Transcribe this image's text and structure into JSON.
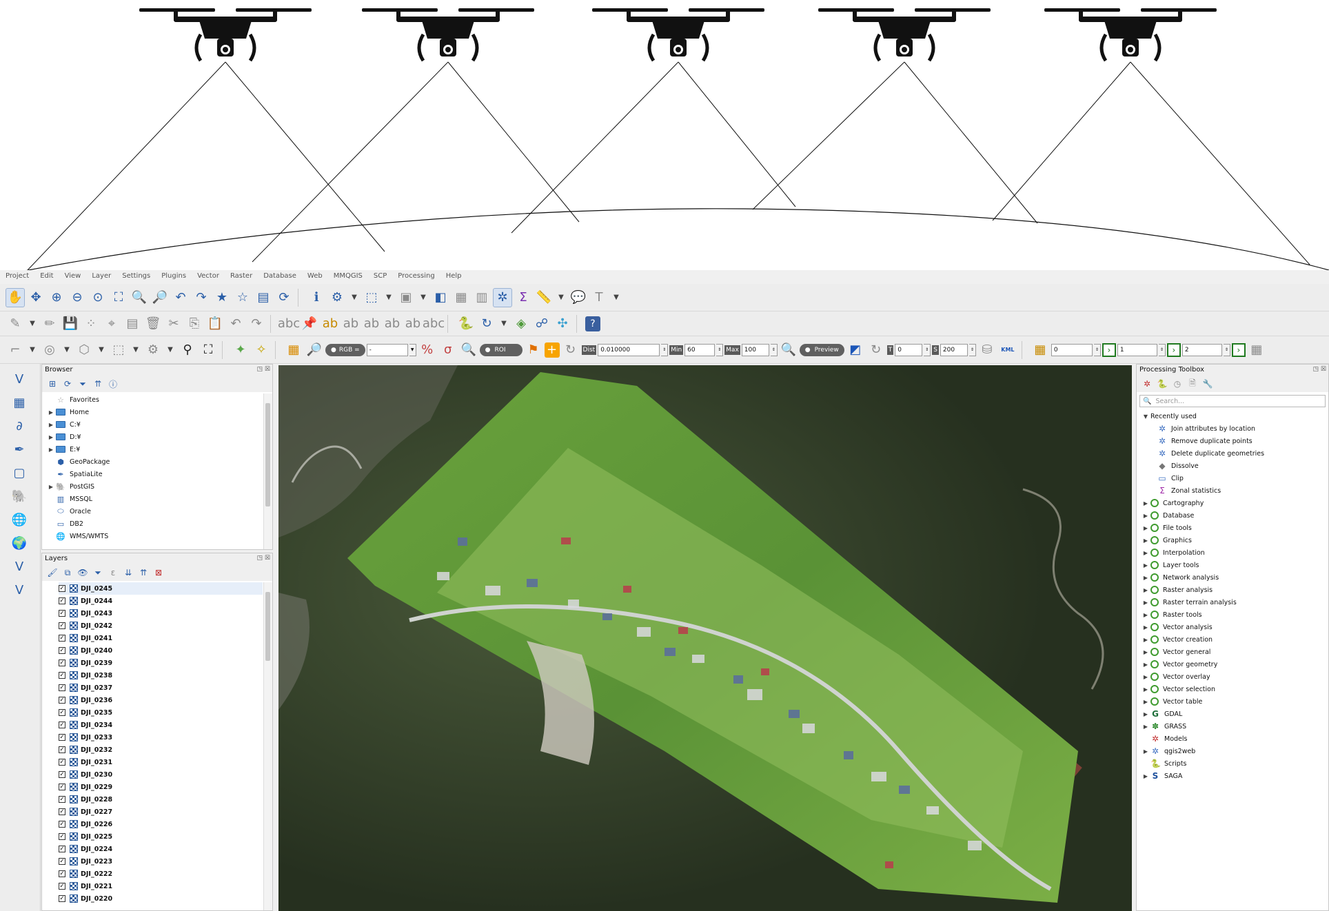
{
  "menu": [
    "Project",
    "Edit",
    "View",
    "Layer",
    "Settings",
    "Plugins",
    "Vector",
    "Raster",
    "Database",
    "Web",
    "MMQGIS",
    "SCP",
    "Processing",
    "Help"
  ],
  "scp": {
    "rgb_label": "RGB =",
    "rgb_value": "-",
    "roi_label": "ROI",
    "dist_label": "Dist",
    "dist_value": "0.010000",
    "min_label": "Min",
    "min_value": "60",
    "max_label": "Max",
    "max_value": "100",
    "preview_label": "Preview",
    "t_label": "T",
    "t_value": "0",
    "s_label": "S",
    "s_value": "200",
    "kml_label": "KML",
    "band1": "0",
    "band2": "1",
    "band3": "2"
  },
  "browser": {
    "title": "Browser",
    "items": [
      {
        "label": "Favorites",
        "icon": "star-icon",
        "expand": false
      },
      {
        "label": "Home",
        "icon": "folder-icon",
        "expand": true
      },
      {
        "label": "C:¥",
        "icon": "folder-icon",
        "expand": true
      },
      {
        "label": "D:¥",
        "icon": "folder-icon",
        "expand": true
      },
      {
        "label": "E:¥",
        "icon": "folder-icon",
        "expand": true
      },
      {
        "label": "GeoPackage",
        "icon": "geopackage-icon",
        "expand": false
      },
      {
        "label": "SpatiaLite",
        "icon": "spatialite-icon",
        "expand": false
      },
      {
        "label": "PostGIS",
        "icon": "postgis-icon",
        "expand": true
      },
      {
        "label": "MSSQL",
        "icon": "mssql-icon",
        "expand": false
      },
      {
        "label": "Oracle",
        "icon": "oracle-icon",
        "expand": false
      },
      {
        "label": "DB2",
        "icon": "db2-icon",
        "expand": false
      },
      {
        "label": "WMS/WMTS",
        "icon": "wms-icon",
        "expand": false
      }
    ]
  },
  "layers": {
    "title": "Layers",
    "items": [
      "DJI_0245",
      "DJI_0244",
      "DJI_0243",
      "DJI_0242",
      "DJI_0241",
      "DJI_0240",
      "DJI_0239",
      "DJI_0238",
      "DJI_0237",
      "DJI_0236",
      "DJI_0235",
      "DJI_0234",
      "DJI_0233",
      "DJI_0232",
      "DJI_0231",
      "DJI_0230",
      "DJI_0229",
      "DJI_0228",
      "DJI_0227",
      "DJI_0226",
      "DJI_0225",
      "DJI_0224",
      "DJI_0223",
      "DJI_0222",
      "DJI_0221",
      "DJI_0220"
    ]
  },
  "toolbox": {
    "title": "Processing Toolbox",
    "search_placeholder": "Search...",
    "recent_label": "Recently used",
    "recent": [
      "Join attributes by location",
      "Remove duplicate points",
      "Delete duplicate geometries",
      "Dissolve",
      "Clip",
      "Zonal statistics"
    ],
    "groups": [
      {
        "label": "Cartography",
        "icon": "qgis-icon"
      },
      {
        "label": "Database",
        "icon": "qgis-icon"
      },
      {
        "label": "File tools",
        "icon": "qgis-icon"
      },
      {
        "label": "Graphics",
        "icon": "qgis-icon"
      },
      {
        "label": "Interpolation",
        "icon": "qgis-icon"
      },
      {
        "label": "Layer tools",
        "icon": "qgis-icon"
      },
      {
        "label": "Network analysis",
        "icon": "qgis-icon"
      },
      {
        "label": "Raster analysis",
        "icon": "qgis-icon"
      },
      {
        "label": "Raster terrain analysis",
        "icon": "qgis-icon"
      },
      {
        "label": "Raster tools",
        "icon": "qgis-icon"
      },
      {
        "label": "Vector analysis",
        "icon": "qgis-icon"
      },
      {
        "label": "Vector creation",
        "icon": "qgis-icon"
      },
      {
        "label": "Vector general",
        "icon": "qgis-icon"
      },
      {
        "label": "Vector geometry",
        "icon": "qgis-icon"
      },
      {
        "label": "Vector overlay",
        "icon": "qgis-icon"
      },
      {
        "label": "Vector selection",
        "icon": "qgis-icon"
      },
      {
        "label": "Vector table",
        "icon": "qgis-icon"
      },
      {
        "label": "GDAL",
        "icon": "gdal-icon"
      },
      {
        "label": "GRASS",
        "icon": "grass-icon"
      },
      {
        "label": "Models",
        "icon": "models-icon"
      },
      {
        "label": "qgis2web",
        "icon": "qgis2web-icon"
      },
      {
        "label": "Scripts",
        "icon": "python-icon"
      },
      {
        "label": "SAGA",
        "icon": "saga-icon"
      }
    ]
  },
  "colors": {
    "accent": "#2b5fa8",
    "qgis_green": "#3f9b2f",
    "map_dark": "#2f3a2a",
    "map_green": "#4f7f2c"
  }
}
